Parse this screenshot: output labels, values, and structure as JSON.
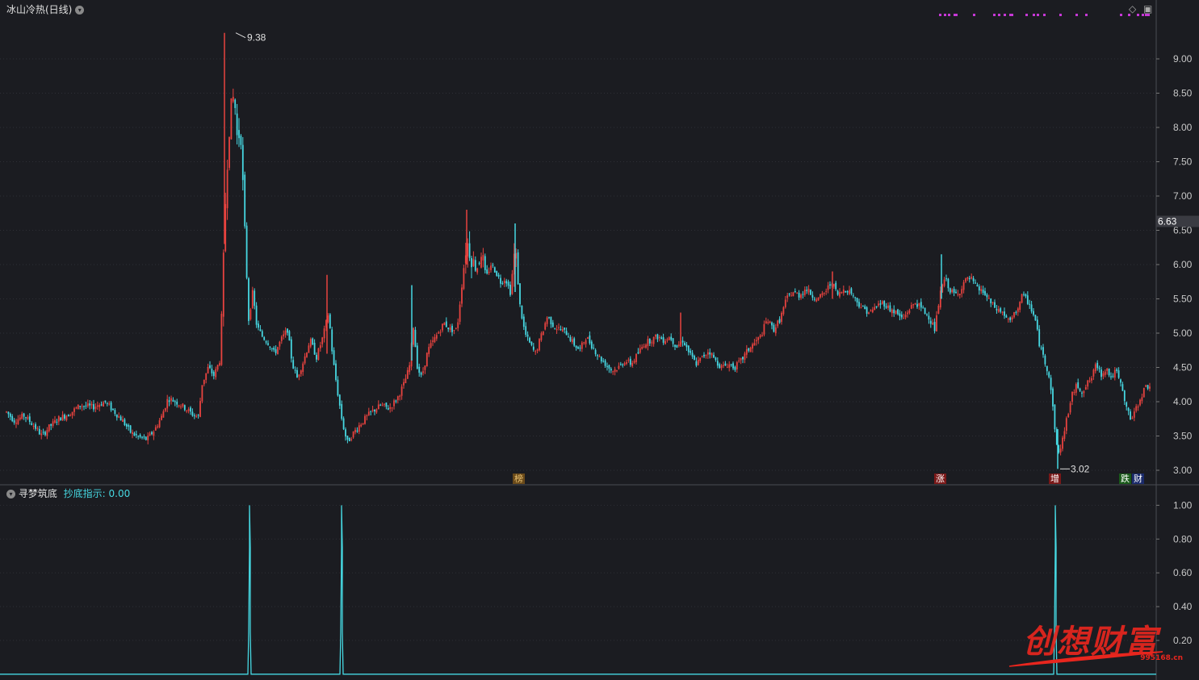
{
  "main_panel": {
    "title": "冰山冷热(日线)",
    "current_price_label": "6.63",
    "high_label": "9.38",
    "low_label": "3.02",
    "badges": [
      {
        "text": "榜",
        "bg": "#6a4a1a",
        "fg": "#e8c070"
      },
      {
        "text": "涨",
        "bg": "#7a1818",
        "fg": "#ffffff"
      },
      {
        "text": "增",
        "bg": "#7a1818",
        "fg": "#ffffff"
      },
      {
        "text": "跌",
        "bg": "#1a5a1a",
        "fg": "#ffffff"
      },
      {
        "text": "财",
        "bg": "#1a2a6a",
        "fg": "#ffffff"
      }
    ]
  },
  "indicator_panel": {
    "title": "寻梦筑底",
    "series_label": "抄底指示:",
    "series_value": "0.00"
  },
  "watermark": {
    "text": "创想财富",
    "url": "995168.cn"
  },
  "colors": {
    "up": "#e8433f",
    "down": "#46d8e2",
    "signal": "#46d8e2",
    "marker": "#c638d6",
    "grid": "#2e2f36"
  },
  "chart_data": [
    {
      "type": "candlestick",
      "y_axis_ticks": [
        "3.00",
        "3.50",
        "4.00",
        "4.50",
        "5.00",
        "5.50",
        "6.00",
        "6.50",
        "7.00",
        "7.50",
        "8.00",
        "8.50",
        "9.00"
      ],
      "ylim": [
        2.8,
        9.6
      ],
      "high": 9.38,
      "low": 3.02,
      "last": 6.63,
      "close_path": [
        [
          0,
          3.95
        ],
        [
          8,
          3.85
        ],
        [
          18,
          3.72
        ],
        [
          30,
          3.8
        ],
        [
          42,
          3.65
        ],
        [
          52,
          3.5
        ],
        [
          60,
          3.62
        ],
        [
          72,
          3.75
        ],
        [
          85,
          3.82
        ],
        [
          100,
          3.95
        ],
        [
          115,
          3.92
        ],
        [
          130,
          4.0
        ],
        [
          142,
          3.85
        ],
        [
          152,
          3.72
        ],
        [
          162,
          3.55
        ],
        [
          172,
          3.48
        ],
        [
          182,
          3.45
        ],
        [
          192,
          3.6
        ],
        [
          200,
          3.78
        ],
        [
          208,
          4.05
        ],
        [
          218,
          4.0
        ],
        [
          228,
          3.92
        ],
        [
          238,
          3.82
        ],
        [
          246,
          3.78
        ],
        [
          250,
          4.25
        ],
        [
          258,
          4.5
        ],
        [
          265,
          4.38
        ],
        [
          272,
          4.6
        ],
        [
          275,
          5.4
        ],
        [
          280,
          7.2
        ],
        [
          285,
          8.2
        ],
        [
          290,
          8.5
        ],
        [
          294,
          7.8
        ],
        [
          298,
          8.0
        ],
        [
          303,
          6.5
        ],
        [
          308,
          5.2
        ],
        [
          313,
          5.6
        ],
        [
          318,
          5.1
        ],
        [
          325,
          4.95
        ],
        [
          333,
          4.85
        ],
        [
          340,
          4.7
        ],
        [
          348,
          4.9
        ],
        [
          356,
          5.05
        ],
        [
          362,
          4.55
        ],
        [
          368,
          4.35
        ],
        [
          376,
          4.6
        ],
        [
          384,
          4.9
        ],
        [
          392,
          4.65
        ],
        [
          400,
          4.95
        ],
        [
          407,
          5.3
        ],
        [
          412,
          4.65
        ],
        [
          418,
          4.15
        ],
        [
          424,
          3.7
        ],
        [
          430,
          3.4
        ],
        [
          438,
          3.55
        ],
        [
          448,
          3.7
        ],
        [
          460,
          3.85
        ],
        [
          472,
          3.95
        ],
        [
          482,
          3.9
        ],
        [
          492,
          4.05
        ],
        [
          500,
          4.25
        ],
        [
          507,
          4.5
        ],
        [
          512,
          5.1
        ],
        [
          517,
          4.5
        ],
        [
          522,
          4.35
        ],
        [
          530,
          4.75
        ],
        [
          540,
          4.95
        ],
        [
          550,
          5.15
        ],
        [
          558,
          5.05
        ],
        [
          566,
          5.05
        ],
        [
          572,
          5.7
        ],
        [
          578,
          6.35
        ],
        [
          584,
          6.1
        ],
        [
          590,
          5.9
        ],
        [
          596,
          6.2
        ],
        [
          602,
          5.8
        ],
        [
          608,
          6.0
        ],
        [
          614,
          5.9
        ],
        [
          620,
          5.75
        ],
        [
          626,
          5.8
        ],
        [
          632,
          5.6
        ],
        [
          638,
          6.25
        ],
        [
          644,
          5.4
        ],
        [
          650,
          5.0
        ],
        [
          656,
          4.85
        ],
        [
          663,
          4.7
        ],
        [
          670,
          4.95
        ],
        [
          678,
          5.25
        ],
        [
          686,
          5.1
        ],
        [
          694,
          5.05
        ],
        [
          702,
          5.0
        ],
        [
          710,
          4.85
        ],
        [
          718,
          4.75
        ],
        [
          726,
          4.95
        ],
        [
          734,
          4.8
        ],
        [
          742,
          4.65
        ],
        [
          750,
          4.55
        ],
        [
          758,
          4.45
        ],
        [
          766,
          4.5
        ],
        [
          774,
          4.6
        ],
        [
          782,
          4.55
        ],
        [
          790,
          4.7
        ],
        [
          798,
          4.85
        ],
        [
          806,
          4.9
        ],
        [
          814,
          4.95
        ],
        [
          822,
          4.9
        ],
        [
          830,
          4.95
        ],
        [
          838,
          4.8
        ],
        [
          846,
          4.9
        ],
        [
          854,
          4.7
        ],
        [
          862,
          4.55
        ],
        [
          870,
          4.65
        ],
        [
          878,
          4.75
        ],
        [
          886,
          4.6
        ],
        [
          894,
          4.5
        ],
        [
          902,
          4.55
        ],
        [
          910,
          4.5
        ],
        [
          918,
          4.6
        ],
        [
          926,
          4.75
        ],
        [
          934,
          4.85
        ],
        [
          942,
          4.95
        ],
        [
          950,
          5.2
        ],
        [
          958,
          5.05
        ],
        [
          966,
          5.2
        ],
        [
          974,
          5.5
        ],
        [
          982,
          5.6
        ],
        [
          990,
          5.55
        ],
        [
          998,
          5.65
        ],
        [
          1006,
          5.55
        ],
        [
          1014,
          5.5
        ],
        [
          1022,
          5.6
        ],
        [
          1030,
          5.75
        ],
        [
          1038,
          5.55
        ],
        [
          1046,
          5.65
        ],
        [
          1054,
          5.6
        ],
        [
          1062,
          5.45
        ],
        [
          1070,
          5.35
        ],
        [
          1078,
          5.3
        ],
        [
          1086,
          5.4
        ],
        [
          1094,
          5.45
        ],
        [
          1102,
          5.35
        ],
        [
          1110,
          5.3
        ],
        [
          1118,
          5.2
        ],
        [
          1126,
          5.35
        ],
        [
          1134,
          5.45
        ],
        [
          1142,
          5.35
        ],
        [
          1150,
          5.25
        ],
        [
          1158,
          5.05
        ],
        [
          1164,
          5.55
        ],
        [
          1170,
          5.8
        ],
        [
          1178,
          5.6
        ],
        [
          1186,
          5.55
        ],
        [
          1194,
          5.75
        ],
        [
          1202,
          5.8
        ],
        [
          1210,
          5.65
        ],
        [
          1218,
          5.6
        ],
        [
          1226,
          5.45
        ],
        [
          1234,
          5.35
        ],
        [
          1242,
          5.3
        ],
        [
          1250,
          5.15
        ],
        [
          1258,
          5.3
        ],
        [
          1266,
          5.55
        ],
        [
          1274,
          5.45
        ],
        [
          1282,
          5.2
        ],
        [
          1288,
          4.8
        ],
        [
          1294,
          4.6
        ],
        [
          1300,
          4.35
        ],
        [
          1305,
          3.8
        ],
        [
          1310,
          3.2
        ],
        [
          1316,
          3.45
        ],
        [
          1322,
          3.8
        ],
        [
          1328,
          4.1
        ],
        [
          1334,
          4.25
        ],
        [
          1340,
          4.15
        ],
        [
          1346,
          4.25
        ],
        [
          1352,
          4.35
        ],
        [
          1358,
          4.55
        ],
        [
          1364,
          4.4
        ],
        [
          1370,
          4.5
        ],
        [
          1376,
          4.35
        ],
        [
          1382,
          4.45
        ],
        [
          1388,
          4.25
        ],
        [
          1394,
          3.95
        ],
        [
          1400,
          3.75
        ],
        [
          1406,
          3.85
        ],
        [
          1412,
          4.05
        ],
        [
          1418,
          4.2
        ],
        [
          1425,
          4.25
        ]
      ],
      "spikes": [
        [
          278,
          6.3,
          9.38,
          "up"
        ],
        [
          1310,
          3.02,
          3.6,
          "down"
        ],
        [
          638,
          6.6,
          5.6,
          "down"
        ],
        [
          578,
          6.8,
          6.0,
          "up"
        ],
        [
          1166,
          6.15,
          5.5,
          "down"
        ],
        [
          405,
          5.85,
          4.7,
          "up"
        ],
        [
          510,
          5.7,
          4.6,
          "down"
        ],
        [
          843,
          5.3,
          4.8,
          "up"
        ],
        [
          1031,
          5.9,
          5.5,
          "up"
        ]
      ]
    },
    {
      "type": "line",
      "name": "抄底指示",
      "y_axis_ticks": [
        "0.20",
        "0.40",
        "0.60",
        "0.80",
        "1.00"
      ],
      "ylim": [
        -0.02,
        1.04
      ],
      "baseline": 0,
      "pulses_at_x": [
        309,
        423,
        1307
      ],
      "pulse_value": 1.0
    }
  ]
}
